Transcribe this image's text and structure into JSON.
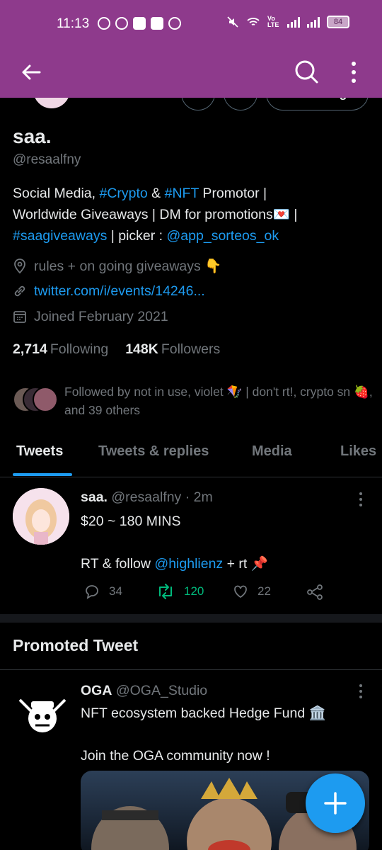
{
  "status_bar": {
    "time": "11:13",
    "battery": "84",
    "network_label": "Vo LTE"
  },
  "app_bar": {
    "back_icon": "arrow-left-icon",
    "search_icon": "search-icon",
    "more_icon": "more-vertical-icon",
    "background": "#8e3a8c"
  },
  "profile": {
    "following_button": "Following",
    "display_name": "saa.",
    "handle": "@resaalfny",
    "bio": {
      "line1_prefix": "Social Media, ",
      "tag_crypto": "#Crypto",
      "and": " & ",
      "tag_nft": "#NFT",
      "line1_suffix": " Promotor |",
      "line2": "Worldwide Giveaways | DM for promotions💌 |",
      "tag_saagiveaways": "#saagiveaways",
      "picker_label": " | picker : ",
      "picker_mention": "@app_sorteos_ok"
    },
    "location": "rules + on going giveaways 👇",
    "link": "twitter.com/i/events/14246...",
    "joined": "Joined February 2021",
    "following_count": "2,714",
    "following_label": "Following",
    "followers_count": "148K",
    "followers_label": "Followers",
    "followed_by": "Followed by not in use, violet 🪁 | don't rt!, crypto sn 🍓, and 39 others"
  },
  "tabs": [
    {
      "label": "Tweets",
      "active": true
    },
    {
      "label": "Tweets & replies",
      "active": false
    },
    {
      "label": "Media",
      "active": false
    },
    {
      "label": "Likes",
      "active": false
    }
  ],
  "tweet": {
    "name": "saa.",
    "handle_time": "@resaalfny · 2m",
    "line1": "$20 ~ 180 MINS",
    "line2_prefix": "RT & follow ",
    "mention": "@highlienz",
    "line2_suffix": " + rt 📌",
    "replies": "34",
    "retweets": "120",
    "likes": "22"
  },
  "promoted": {
    "title": "Promoted Tweet",
    "name": "OGA",
    "handle": "@OGA_Studio",
    "line1": "NFT ecosystem backed Hedge Fund 🏛️",
    "line2": "Join the OGA community now !"
  },
  "fab": {
    "icon": "plus-icon",
    "color": "#1d9bf0"
  }
}
